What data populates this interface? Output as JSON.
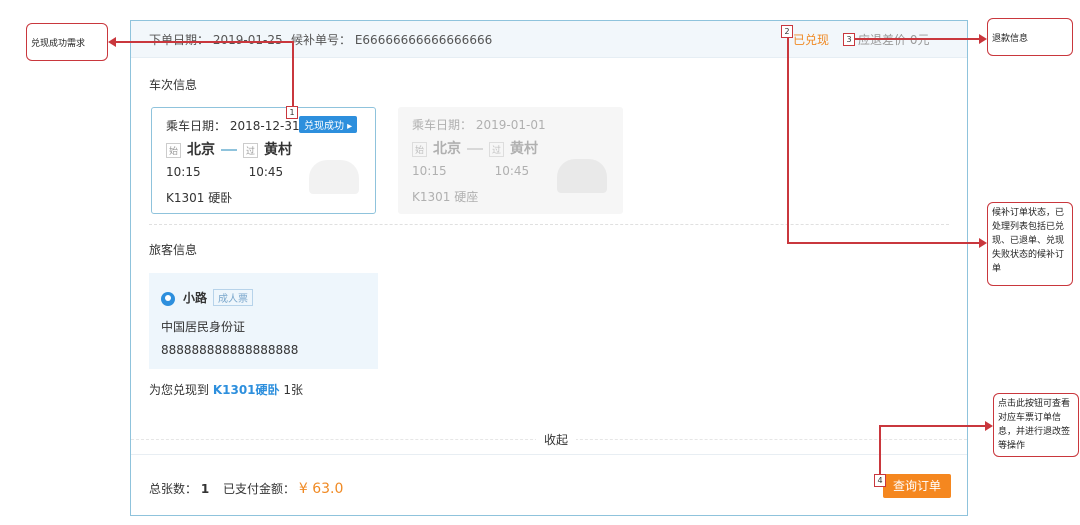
{
  "order": {
    "date_label": "下单日期：",
    "date": "2019-01-25",
    "number_label": "候补单号：",
    "number": "E66666666666666666",
    "status": "已兑现",
    "refund_label": "应退差价 0元"
  },
  "sections": {
    "train_info": "车次信息",
    "passenger_info": "旅客信息"
  },
  "tickets": [
    {
      "date_label": "乘车日期：",
      "date": "2018-12-31",
      "badge": "兑现成功 ▸",
      "from_tag": "始",
      "from": "北京",
      "via_tag": "过",
      "to": "黄村",
      "depart": "10:15",
      "arrive": "10:45",
      "train": "K1301 硬卧"
    },
    {
      "date_label": "乘车日期：",
      "date": "2019-01-01",
      "from_tag": "始",
      "from": "北京",
      "via_tag": "过",
      "to": "黄村",
      "depart": "10:15",
      "arrive": "10:45",
      "train": "K1301 硬座"
    }
  ],
  "passenger": {
    "name": "小路",
    "type": "成人票",
    "id_type": "中国居民身份证",
    "id_number": "888888888888888888"
  },
  "confirm": {
    "prefix": "为您兑现到 ",
    "train": "K1301硬卧",
    "suffix": " 1张"
  },
  "collapse_label": "收起",
  "footer": {
    "count_label": "总张数：",
    "count": "1",
    "paid_label": "已支付金额：",
    "paid_amount": "¥ 63.0",
    "query_button": "查询订单"
  },
  "annotations": {
    "left": "兑现成功需求",
    "right1": "退款信息",
    "right2": "候补订单状态，已处理列表包括已兑现、已退单、兑现失败状态的候补订单",
    "right3": "点击此按钮可查看对应车票订单信息，并进行退改签等操作",
    "num1": "1",
    "num2": "2",
    "num3": "3",
    "num4": "4"
  },
  "colors": {
    "accent": "#2d8fdd",
    "orange": "#f5871f",
    "annotation_red": "#c9373d"
  }
}
